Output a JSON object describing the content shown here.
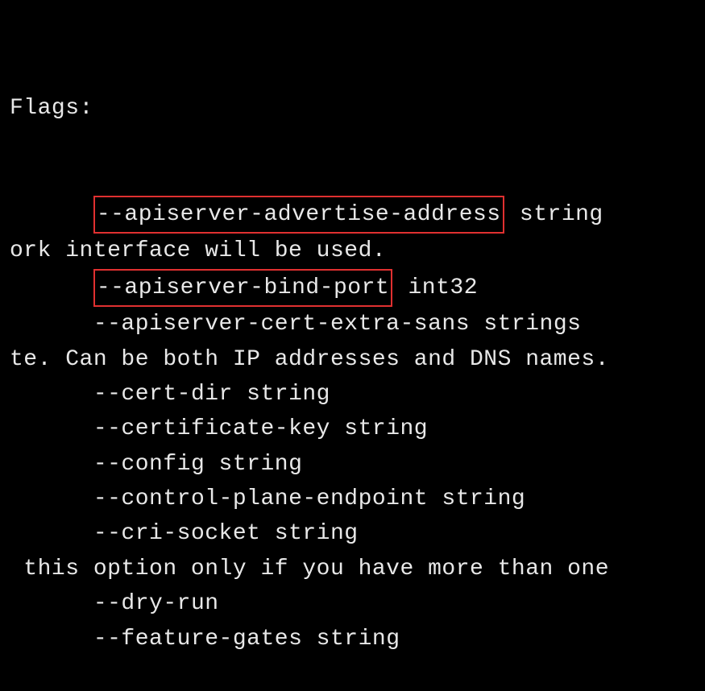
{
  "header": "Flags:",
  "indent": "      ",
  "lines": [
    {
      "prefix": "      ",
      "flag": "--apiserver-advertise-address",
      "type": " string",
      "highlight": true
    },
    {
      "raw": "ork interface will be used."
    },
    {
      "prefix": "      ",
      "flag": "--apiserver-bind-port",
      "type": " int32",
      "highlight": true
    },
    {
      "prefix": "      ",
      "flag": "--apiserver-cert-extra-sans",
      "type": " strings",
      "highlight": false
    },
    {
      "raw": "te. Can be both IP addresses and DNS names."
    },
    {
      "prefix": "      ",
      "flag": "--cert-dir",
      "type": " string",
      "highlight": false
    },
    {
      "prefix": "      ",
      "flag": "--certificate-key",
      "type": " string",
      "highlight": false
    },
    {
      "prefix": "      ",
      "flag": "--config",
      "type": " string",
      "highlight": false
    },
    {
      "prefix": "      ",
      "flag": "--control-plane-endpoint",
      "type": " string",
      "highlight": false
    },
    {
      "prefix": "      ",
      "flag": "--cri-socket",
      "type": " string",
      "highlight": false
    },
    {
      "raw": " this option only if you have more than one"
    },
    {
      "prefix": "      ",
      "flag": "--dry-run",
      "type": "",
      "highlight": false
    },
    {
      "prefix": "      ",
      "flag": "--feature-gates",
      "type": " string",
      "highlight": false
    }
  ]
}
